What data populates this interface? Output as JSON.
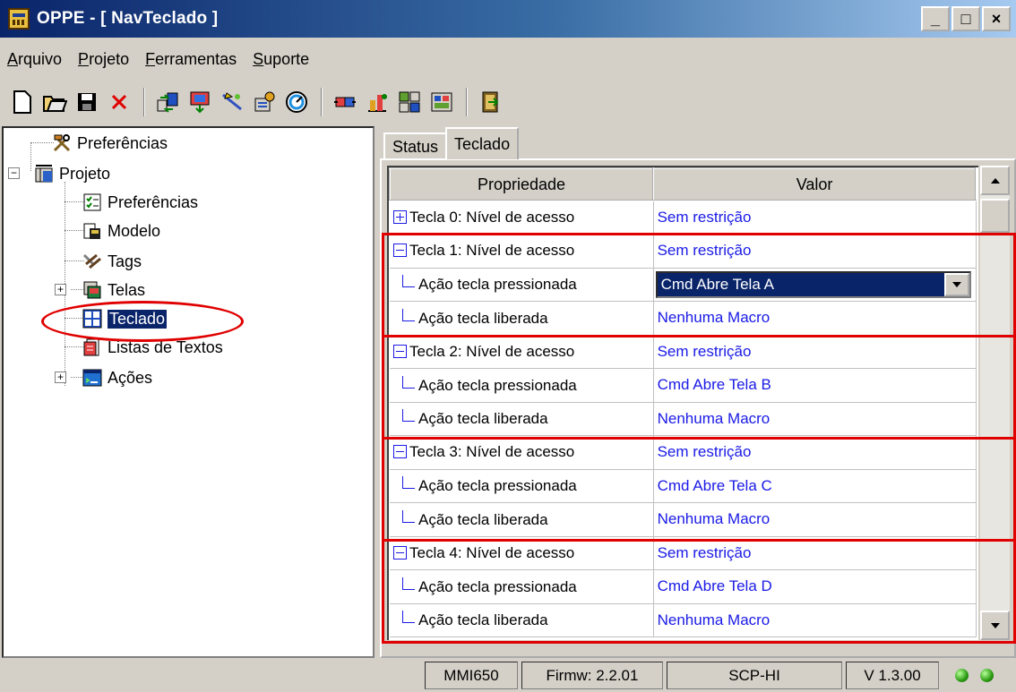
{
  "window": {
    "title": "OPPE - [ NavTeclado ]",
    "minimize": "_",
    "maximize": "□",
    "close": "×"
  },
  "menu": [
    {
      "accel": "A",
      "rest": "rquivo"
    },
    {
      "accel": "P",
      "rest": "rojeto"
    },
    {
      "accel": "F",
      "rest": "erramentas"
    },
    {
      "accel": "S",
      "rest": "uporte"
    }
  ],
  "toolbar": {
    "icons": [
      "new-file-icon",
      "open-folder-icon",
      "save-icon",
      "delete-icon",
      "transfer-icon",
      "download-icon",
      "tool-icon",
      "config-icon",
      "refresh-icon",
      "plug-icon",
      "run-icon",
      "keypad-icon",
      "display-icon",
      "exit-icon"
    ]
  },
  "tree": {
    "items": [
      {
        "label": "Preferências",
        "icon": "tools-icon"
      },
      {
        "label": "Projeto",
        "icon": "project-icon"
      },
      {
        "label": "Preferências",
        "icon": "checklist-icon"
      },
      {
        "label": "Modelo",
        "icon": "model-icon"
      },
      {
        "label": "Tags",
        "icon": "tags-icon"
      },
      {
        "label": "Telas",
        "icon": "screens-icon"
      },
      {
        "label": "Teclado",
        "icon": "keyboard-icon"
      },
      {
        "label": "Listas de Textos",
        "icon": "text-list-icon"
      },
      {
        "label": "Ações",
        "icon": "actions-icon"
      }
    ]
  },
  "tabs": [
    {
      "label": "Status"
    },
    {
      "label": "Teclado"
    }
  ],
  "grid": {
    "columns": [
      "Propriedade",
      "Valor"
    ],
    "rows": [
      {
        "kind": "parent",
        "expander": "plus",
        "prop": "Tecla 0: Nível de acesso",
        "value": "Sem restrição"
      },
      {
        "kind": "parent",
        "expander": "minus",
        "prop": "Tecla 1: Nível de acesso",
        "value": "Sem restrição"
      },
      {
        "kind": "child",
        "prop": "Ação tecla pressionada",
        "value": "Cmd Abre Tela A",
        "editing": true
      },
      {
        "kind": "child",
        "prop": "Ação tecla liberada",
        "value": "Nenhuma Macro"
      },
      {
        "kind": "parent",
        "expander": "minus",
        "prop": "Tecla 2: Nível de acesso",
        "value": "Sem restrição"
      },
      {
        "kind": "child",
        "prop": "Ação tecla pressionada",
        "value": "Cmd Abre Tela B"
      },
      {
        "kind": "child",
        "prop": "Ação tecla liberada",
        "value": "Nenhuma Macro"
      },
      {
        "kind": "parent",
        "expander": "minus",
        "prop": "Tecla 3: Nível de acesso",
        "value": "Sem restrição"
      },
      {
        "kind": "child",
        "prop": "Ação tecla pressionada",
        "value": "Cmd Abre Tela C"
      },
      {
        "kind": "child",
        "prop": "Ação tecla liberada",
        "value": "Nenhuma Macro"
      },
      {
        "kind": "parent",
        "expander": "minus",
        "prop": "Tecla 4: Nível de acesso",
        "value": "Sem restrição"
      },
      {
        "kind": "child",
        "prop": "Ação tecla pressionada",
        "value": "Cmd Abre Tela D"
      },
      {
        "kind": "child",
        "prop": "Ação tecla liberada",
        "value": "Nenhuma Macro"
      }
    ]
  },
  "statusbar": {
    "model": "MMI650",
    "firmware": "Firmw: 2.2.01",
    "protocol": "SCP-HI",
    "version": "V 1.3.00"
  },
  "colors": {
    "highlight": "#e00000",
    "link_blue": "#1a1ae6",
    "selection": "#0a246a"
  }
}
